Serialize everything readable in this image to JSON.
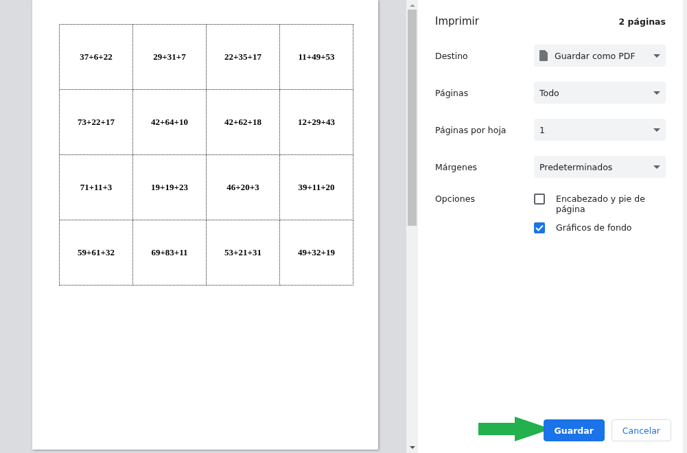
{
  "preview": {
    "grid": [
      [
        "37+6+22",
        "29+31+7",
        "22+35+17",
        "11+49+53"
      ],
      [
        "73+22+17",
        "42+64+10",
        "42+62+18",
        "12+29+43"
      ],
      [
        "71+11+3",
        "19+19+23",
        "46+20+3",
        "39+11+20"
      ],
      [
        "59+61+32",
        "69+83+11",
        "53+21+31",
        "49+32+19"
      ]
    ]
  },
  "panel": {
    "title": "Imprimir",
    "page_count": "2 páginas",
    "settings": [
      {
        "label": "Destino",
        "value": "Guardar como PDF",
        "kind": "file"
      },
      {
        "label": "Páginas",
        "value": "Todo",
        "kind": "plain"
      },
      {
        "label": "Páginas por hoja",
        "value": "1",
        "kind": "plain"
      },
      {
        "label": "Márgenes",
        "value": "Predeterminados",
        "kind": "plain"
      }
    ],
    "options_label": "Opciones",
    "options": [
      {
        "label": "Encabezado y pie de página",
        "checked": false
      },
      {
        "label": "Gráficos de fondo",
        "checked": true
      }
    ],
    "buttons": [
      {
        "label": "Guardar",
        "kind": "primary"
      },
      {
        "label": "Cancelar",
        "kind": "secondary"
      }
    ]
  }
}
